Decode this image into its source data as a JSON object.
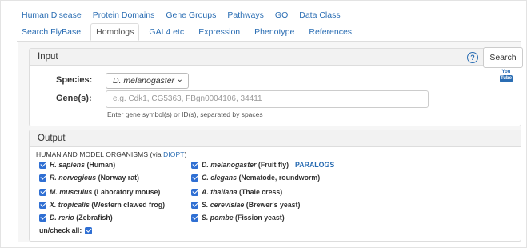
{
  "nav": {
    "top_tabs": [
      "Human Disease",
      "Protein Domains",
      "Gene Groups",
      "Pathways",
      "GO",
      "Data Class"
    ],
    "sub_tabs": [
      "Search FlyBase",
      "Homologs",
      "GAL4 etc",
      "Expression",
      "Phenotype",
      "References"
    ],
    "active_sub_tab": "Homologs"
  },
  "input_panel": {
    "heading": "Input",
    "species_label": "Species:",
    "species_value": "D. melanogaster",
    "genes_label": "Gene(s):",
    "genes_placeholder": "e.g. Cdk1, CG5363, FBgn0004106, 34411",
    "hint": "Enter gene symbol(s) or ID(s), separated by spaces"
  },
  "output_panel": {
    "heading": "Output",
    "section_title": "HUMAN AND MODEL ORGANISMS (via ",
    "section_link": "DIOPT",
    "section_tail": ")",
    "left_organisms": [
      {
        "species": "H. sapiens",
        "common": "(Human)",
        "checked": true
      },
      {
        "species": "R. norvegicus",
        "common": "(Norway rat)",
        "checked": true
      },
      {
        "species": "M. musculus",
        "common": "(Laboratory mouse)",
        "checked": true
      },
      {
        "species": "X. tropicalis",
        "common": "(Western clawed frog)",
        "checked": true
      },
      {
        "species": "D. rerio",
        "common": "(Zebrafish)",
        "checked": true
      }
    ],
    "right_organisms": [
      {
        "species": "D. melanogaster",
        "common": "(Fruit fly)",
        "checked": true
      },
      {
        "species": "C. elegans",
        "common": "(Nematode, roundworm)",
        "checked": true
      },
      {
        "species": "A. thaliana",
        "common": "(Thale cress)",
        "checked": true
      },
      {
        "species": "S. cerevisiae",
        "common": "(Brewer's yeast)",
        "checked": true
      },
      {
        "species": "S. pombe",
        "common": "(Fission yeast)",
        "checked": true
      }
    ],
    "paralogs_link": "PARALOGS",
    "uncheck_label": "un/check all:"
  },
  "actions": {
    "help_icon": "question-circle-icon",
    "search_label": "Search",
    "youtube_top": "You",
    "youtube_box": "Tube",
    "youtube_icon": "youtube-icon"
  },
  "colors": {
    "link": "#2a6db3",
    "checkbox": "#2f6fd3"
  }
}
